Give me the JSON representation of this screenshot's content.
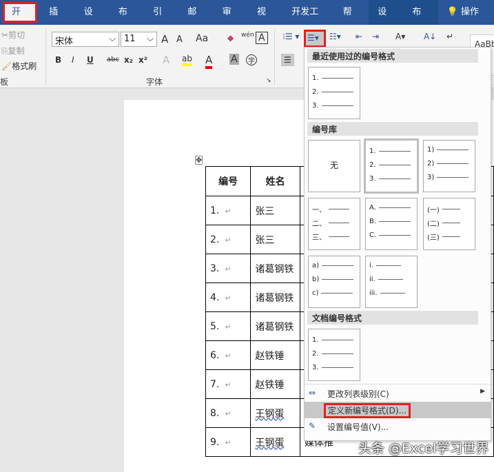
{
  "tabs": [
    "开始",
    "插入",
    "设计",
    "布局",
    "引用",
    "邮件",
    "审阅",
    "视图",
    "开发工具",
    "帮助",
    "设计",
    "布局"
  ],
  "tell_me": "操作说",
  "clipboard": {
    "cut": "剪切",
    "copy": "复制",
    "format_painter": "格式刷",
    "group": "板"
  },
  "font": {
    "name": "宋体",
    "size": "11",
    "group": "字体",
    "bold": "B",
    "italic": "I",
    "underline": "U",
    "strike": "abc",
    "sub": "x₂",
    "sup": "x²",
    "grow": "A",
    "shrink": "A",
    "case": "Aa",
    "phonetic": "wén",
    "border": "A"
  },
  "styles_preview": "AaBb",
  "menu": {
    "recent_header": "最近使用过的编号格式",
    "library_header": "编号库",
    "document_header": "文档编号格式",
    "none_label": "无",
    "formats": {
      "num_dot": [
        "1.",
        "2.",
        "3."
      ],
      "num_paren": [
        "1)",
        "2)",
        "3)"
      ],
      "cn_comma": [
        "一、",
        "二、",
        "三、"
      ],
      "alpha_upper": [
        "A.",
        "B.",
        "C."
      ],
      "cn_paren": [
        "(一)",
        "(二)",
        "(三)"
      ],
      "alpha_paren": [
        "a)",
        "b)",
        "c)"
      ],
      "roman": [
        "i.",
        "ii.",
        "iii."
      ]
    },
    "items": [
      "更改列表级别(C)",
      "定义新编号格式(D)...",
      "设置编号值(V)..."
    ]
  },
  "table": {
    "headers": [
      "编号",
      "姓名"
    ],
    "rows": [
      [
        "1.",
        "张三"
      ],
      [
        "2.",
        "张三"
      ],
      [
        "3.",
        "诸葛钢铁"
      ],
      [
        "4.",
        "诸葛钢铁"
      ],
      [
        "5.",
        "诸葛钢铁"
      ],
      [
        "6.",
        "赵铁锤"
      ],
      [
        "7.",
        "赵铁锤"
      ],
      [
        "8.",
        "王钢蛋"
      ],
      [
        "9.",
        "王钢蛋"
      ]
    ],
    "last_row_col3": "媒体推"
  },
  "watermark": "头条 @Excel学习世界"
}
